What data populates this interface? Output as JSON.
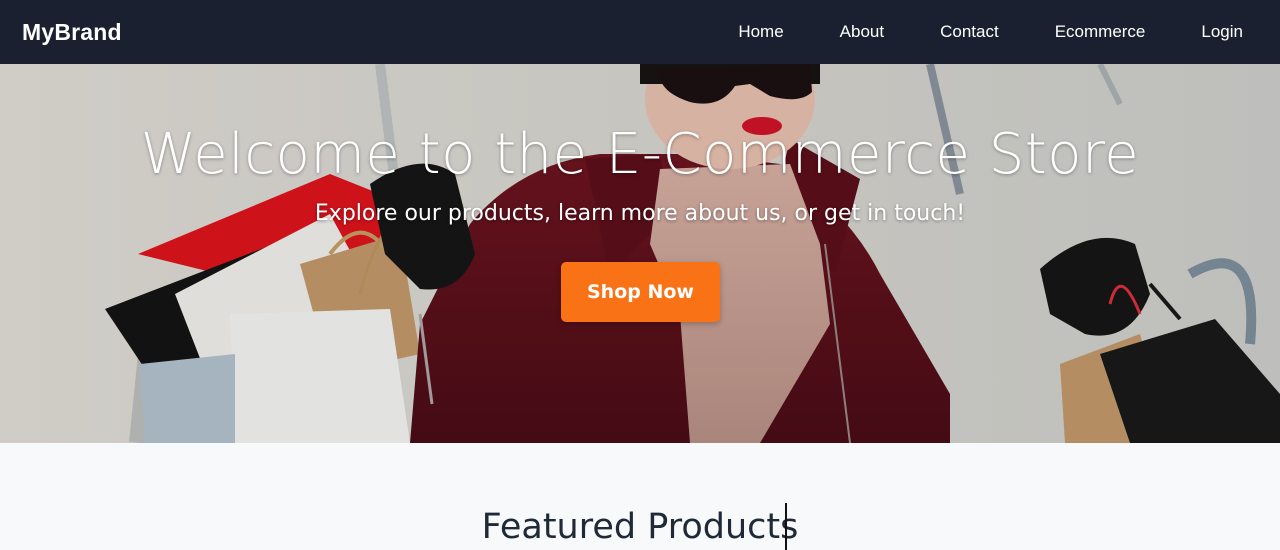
{
  "navbar": {
    "brand": "MyBrand",
    "links": [
      "Home",
      "About",
      "Contact",
      "Ecommerce",
      "Login"
    ],
    "background_color": "#1b2030"
  },
  "hero": {
    "title": "Welcome to the E-Commerce Store",
    "subtitle": "Explore our products, learn more about us, or get in touch!",
    "cta_label": "Shop Now",
    "cta_color": "#f97316",
    "image": "photo of a woman in sunglasses and a red coat holding shopping bags"
  },
  "featured": {
    "title": "Featured Products"
  }
}
